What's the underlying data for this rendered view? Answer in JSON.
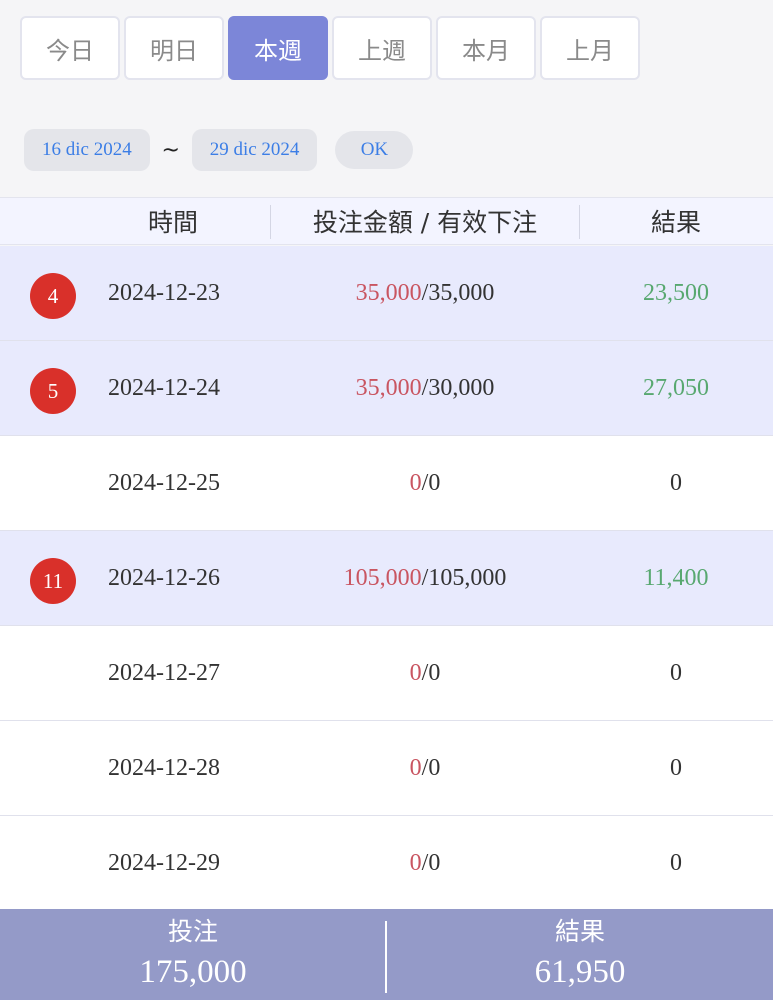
{
  "tabs": [
    {
      "label": "今日",
      "active": false
    },
    {
      "label": "明日",
      "active": false
    },
    {
      "label": "本週",
      "active": true
    },
    {
      "label": "上週",
      "active": false
    },
    {
      "label": "本月",
      "active": false
    },
    {
      "label": "上月",
      "active": false
    }
  ],
  "date_range": {
    "start": "16 dic 2024",
    "separator": "~",
    "end": "29 dic 2024",
    "ok_label": "OK"
  },
  "table": {
    "headers": {
      "time": "時間",
      "bet": "投注金額 / 有效下注",
      "result": "結果"
    },
    "rows": [
      {
        "badge": "4",
        "date": "2024-12-23",
        "bet": "35,000",
        "valid": "35,000",
        "result": "23,500",
        "highlight": true
      },
      {
        "badge": "5",
        "date": "2024-12-24",
        "bet": "35,000",
        "valid": "30,000",
        "result": "27,050",
        "highlight": true
      },
      {
        "badge": "",
        "date": "2024-12-25",
        "bet": "0",
        "valid": "0",
        "result": "0",
        "highlight": false
      },
      {
        "badge": "11",
        "date": "2024-12-26",
        "bet": "105,000",
        "valid": "105,000",
        "result": "11,400",
        "highlight": true
      },
      {
        "badge": "",
        "date": "2024-12-27",
        "bet": "0",
        "valid": "0",
        "result": "0",
        "highlight": false
      },
      {
        "badge": "",
        "date": "2024-12-28",
        "bet": "0",
        "valid": "0",
        "result": "0",
        "highlight": false
      },
      {
        "badge": "",
        "date": "2024-12-29",
        "bet": "0",
        "valid": "0",
        "result": "0",
        "highlight": false
      }
    ]
  },
  "footer": {
    "bet_label": "投注",
    "bet_total": "175,000",
    "result_label": "結果",
    "result_total": "61,950"
  },
  "colors": {
    "active_tab": "#7c86d8",
    "highlight_row": "#e8eafd",
    "badge": "#d9302a",
    "bet_amount": "#c95561",
    "positive_result": "#58a870",
    "date_text": "#3c7ee6",
    "footer": "#949ac8"
  }
}
